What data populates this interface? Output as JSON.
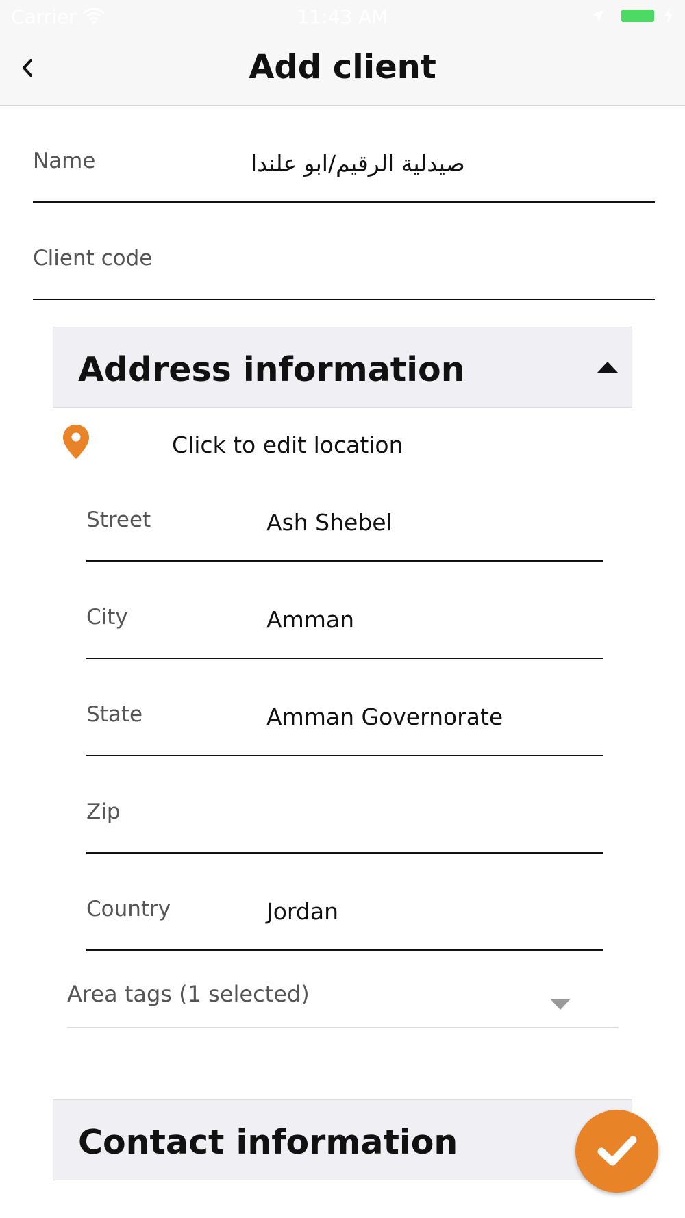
{
  "status_bar": {
    "carrier": "Carrier",
    "time": "11:43 AM",
    "battery_color": "#4cd964"
  },
  "nav": {
    "title": "Add client",
    "back_icon": "chevron-left-icon"
  },
  "form": {
    "name_label": "Name",
    "name_value": "صيدلية الرقيم/ابو علندا",
    "client_code_label": "Client code",
    "client_code_value": ""
  },
  "address": {
    "header": "Address information",
    "collapse_icon": "caret-up-icon",
    "location_label": "Click to edit location",
    "location_icon": "map-pin-icon",
    "street_label": "Street",
    "street_value": "Ash Shebel",
    "city_label": "City",
    "city_value": "Amman",
    "state_label": "State",
    "state_value": "Amman Governorate",
    "zip_label": "Zip",
    "zip_value": "",
    "country_label": "Country",
    "country_value": "Jordan",
    "area_tags_label": "Area tags (1 selected)",
    "area_tags_icon": "caret-down-icon"
  },
  "contact": {
    "header": "Contact information"
  },
  "fab": {
    "icon": "checkmark-icon",
    "color": "#e88327"
  },
  "colors": {
    "accent": "#e88327",
    "section_bg": "#efeff4"
  }
}
